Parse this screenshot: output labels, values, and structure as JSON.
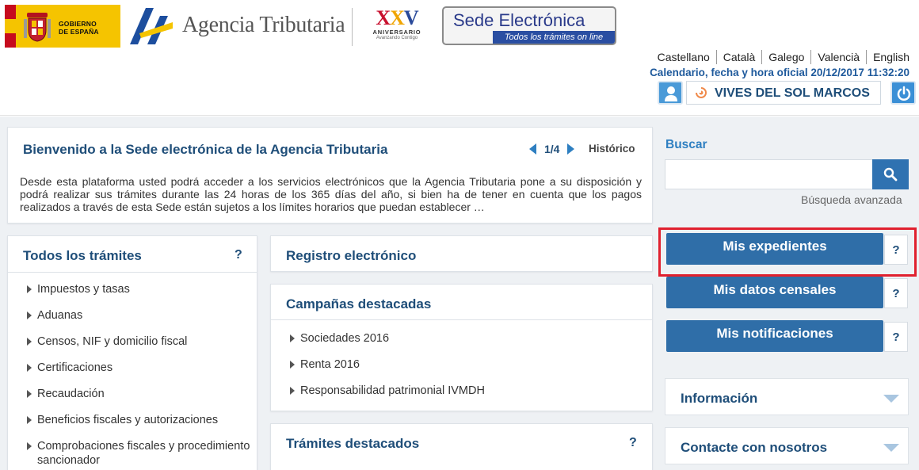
{
  "header": {
    "gobierno_text": "GOBIERNO\nDE ESPAÑA",
    "agency_name": "Agencia Tributaria",
    "anniversary_number": "XXV",
    "anniversary_label": "ANIVERSARIO",
    "anniversary_tagline": "Avanzando Contigo",
    "sede_title": "Sede Electrónica",
    "sede_subtitle": "Todos los trámites on line",
    "languages": [
      "Castellano",
      "Català",
      "Galego",
      "Valencià",
      "English"
    ],
    "datetime": "Calendario, fecha y hora oficial 20/12/2017 11:32:20",
    "user_name": "VIVES DEL SOL MARCOS"
  },
  "welcome": {
    "title": "Bienvenido a la Sede electrónica de la Agencia Tributaria",
    "pager": "1/4",
    "historico": "Histórico",
    "text": "Desde esta plataforma usted podrá acceder a los servicios electrónicos que la Agencia Tributaria pone a su disposición y podrá realizar sus trámites durante las 24 horas de los 365 días del año, si bien ha de tener en cuenta que los pagos realizados a través de esta Sede están sujetos a los límites horarios que puedan establecer …"
  },
  "todos": {
    "title": "Todos los trámites",
    "help": "?",
    "items": [
      "Impuestos y tasas",
      "Aduanas",
      "Censos, NIF y domicilio fiscal",
      "Certificaciones",
      "Recaudación",
      "Beneficios fiscales y autorizaciones",
      "Comprobaciones fiscales y procedimiento sancionador"
    ]
  },
  "registro": {
    "title": "Registro electrónico"
  },
  "campanas": {
    "title": "Campañas destacadas",
    "items": [
      "Sociedades 2016",
      "Renta 2016",
      "Responsabilidad patrimonial IVMDH"
    ]
  },
  "destacados": {
    "title": "Trámites destacados",
    "help": "?"
  },
  "search": {
    "label": "Buscar",
    "placeholder": "",
    "advanced": "Búsqueda avanzada"
  },
  "actions": [
    {
      "label": "Mis expedientes",
      "help": "?"
    },
    {
      "label": "Mis datos censales",
      "help": "?"
    },
    {
      "label": "Mis notificaciones",
      "help": "?"
    }
  ],
  "accordions": [
    {
      "title": "Información"
    },
    {
      "title": "Contacte con nosotros"
    }
  ],
  "colors": {
    "primary_blue": "#2f6ea8",
    "title_blue": "#1f4e79",
    "highlight_red": "#e0202e",
    "gob_yellow": "#f5c400"
  },
  "icons": [
    "user-icon",
    "target-icon",
    "power-icon",
    "search-icon",
    "chevron-left-icon",
    "chevron-right-icon",
    "chevron-down-icon",
    "help-icon"
  ]
}
